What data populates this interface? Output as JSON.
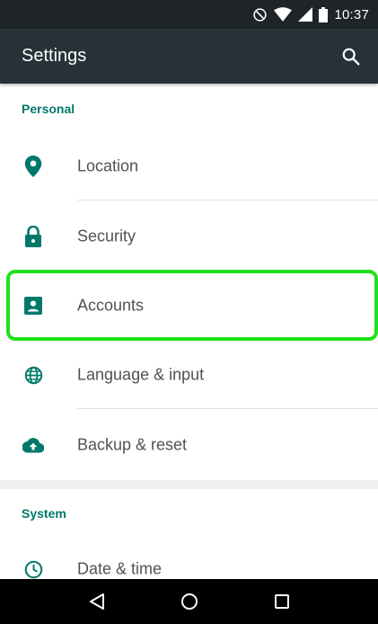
{
  "status_bar": {
    "time": "10:37",
    "icons": [
      "do-not-disturb-icon",
      "wifi-icon",
      "signal-icon",
      "battery-icon"
    ]
  },
  "app_bar": {
    "title": "Settings",
    "search_icon": "search-icon"
  },
  "sections": [
    {
      "header": "Personal",
      "items": [
        {
          "label": "Location",
          "icon": "location-pin-icon"
        },
        {
          "label": "Security",
          "icon": "lock-icon"
        },
        {
          "label": "Accounts",
          "icon": "account-box-icon",
          "highlighted": true
        },
        {
          "label": "Language & input",
          "icon": "globe-icon"
        },
        {
          "label": "Backup & reset",
          "icon": "cloud-upload-icon"
        }
      ]
    },
    {
      "header": "System",
      "items": [
        {
          "label": "Date & time",
          "icon": "clock-icon"
        }
      ]
    }
  ],
  "nav_bar": {
    "icons": [
      "back-icon",
      "home-icon",
      "recents-icon"
    ]
  },
  "colors": {
    "status_bar": "#1f2428",
    "app_bar": "#263238",
    "accent": "#00796b",
    "highlight": "#22e01c"
  }
}
